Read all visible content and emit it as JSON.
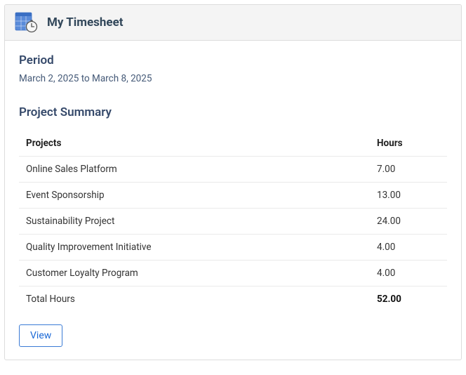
{
  "header": {
    "title": "My Timesheet"
  },
  "period": {
    "label": "Period",
    "value": "March 2, 2025 to March 8, 2025"
  },
  "summary": {
    "title": "Project Summary",
    "columns": {
      "project": "Projects",
      "hours": "Hours"
    },
    "rows": [
      {
        "project": "Online Sales Platform",
        "hours": "7.00"
      },
      {
        "project": "Event Sponsorship",
        "hours": "13.00"
      },
      {
        "project": "Sustainability Project",
        "hours": "24.00"
      },
      {
        "project": "Quality Improvement Initiative",
        "hours": "4.00"
      },
      {
        "project": "Customer Loyalty Program",
        "hours": "4.00"
      }
    ],
    "total": {
      "label": "Total Hours",
      "hours": "52.00"
    }
  },
  "actions": {
    "view_label": "View"
  }
}
